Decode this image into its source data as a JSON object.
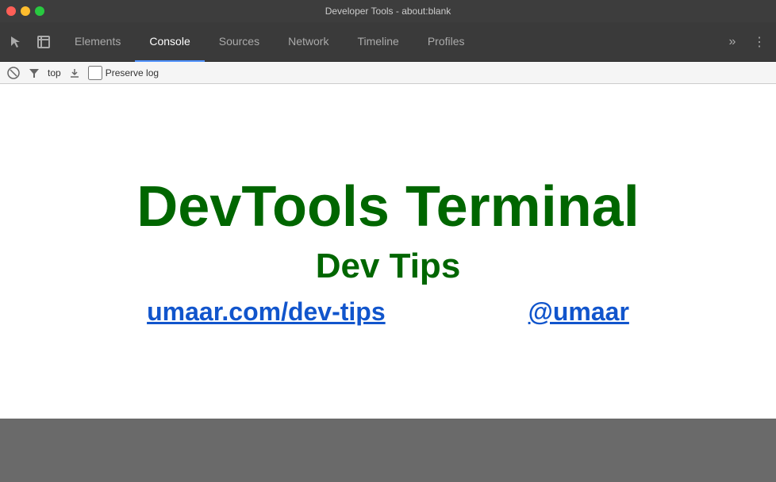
{
  "window": {
    "title": "Developer Tools - about:blank"
  },
  "traffic_lights": {
    "close_label": "",
    "minimize_label": "",
    "maximize_label": ""
  },
  "toolbar": {
    "cursor_icon": "↖",
    "box_icon": "⬜",
    "more_icon": "⋮",
    "chevron_icon": "»"
  },
  "nav": {
    "tabs": [
      {
        "id": "elements",
        "label": "Elements",
        "active": false
      },
      {
        "id": "console",
        "label": "Console",
        "active": true
      },
      {
        "id": "sources",
        "label": "Sources",
        "active": false
      },
      {
        "id": "network",
        "label": "Network",
        "active": false
      },
      {
        "id": "timeline",
        "label": "Timeline",
        "active": false
      },
      {
        "id": "profiles",
        "label": "Profiles",
        "active": false
      }
    ]
  },
  "console_toolbar": {
    "clear_icon": "🚫",
    "filter_icon": "▼",
    "filter_label": "top",
    "download_icon": "⬇",
    "checkbox_label": "Preserve log"
  },
  "main": {
    "headline": "DevTools Terminal",
    "subtitle": "Dev Tips",
    "link_left": "umaar.com/dev-tips",
    "link_right": "@umaar"
  },
  "colors": {
    "headline": "#006600",
    "link": "#1155cc",
    "active_tab_border": "#4d90fe"
  }
}
